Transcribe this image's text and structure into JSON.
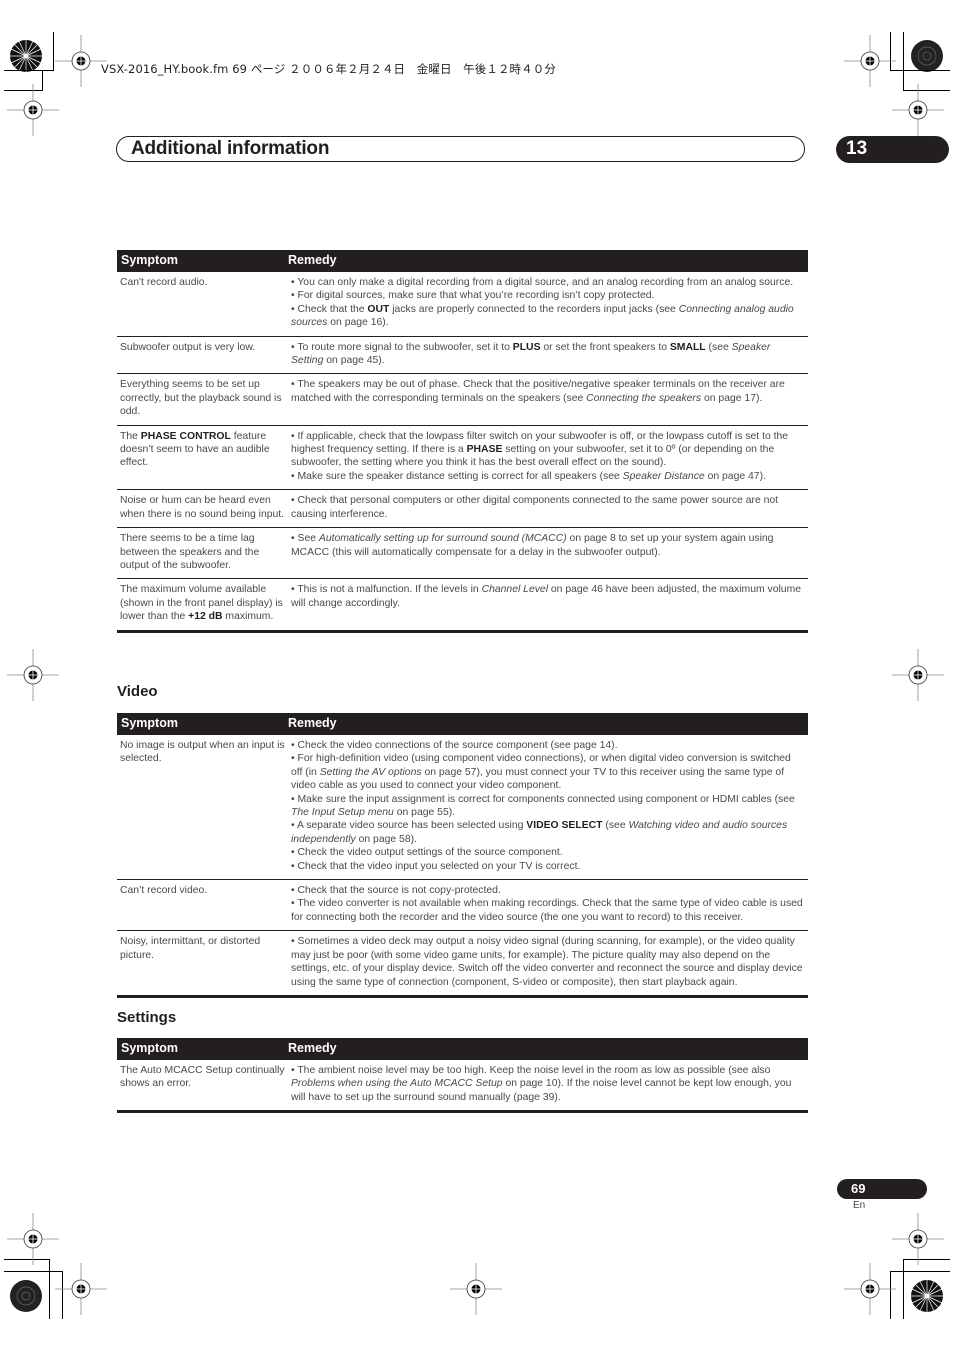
{
  "file_line": "VSX-2016_HY.book.fm  69 ページ  ２００６年２月２４日　金曜日　午後１２時４０分",
  "chapter": {
    "title": "Additional information",
    "number": "13"
  },
  "table_headers": {
    "symptom": "Symptom",
    "remedy": "Remedy"
  },
  "sections": [
    {
      "heading": "",
      "rows": [
        {
          "symptom": [
            {
              "t": "Can't record audio."
            }
          ],
          "remedy": [
            [
              {
                "t": "• You can only make a digital recording from a digital source, and an analog recording from an analog source."
              }
            ],
            [
              {
                "t": "• For digital sources, make sure that what you’re recording isn’t copy protected."
              }
            ],
            [
              {
                "t": "• Check that the "
              },
              {
                "t": "OUT",
                "b": true
              },
              {
                "t": " jacks are properly connected to the recorders input jacks (see "
              },
              {
                "t": "Connecting analog audio sources",
                "i": true
              },
              {
                "t": " on page 16)."
              }
            ]
          ]
        },
        {
          "symptom": [
            {
              "t": "Subwoofer output is very low."
            }
          ],
          "remedy": [
            [
              {
                "t": "• To route more signal to the subwoofer, set it to "
              },
              {
                "t": "PLUS",
                "b": true
              },
              {
                "t": " or set the front speakers to "
              },
              {
                "t": "SMALL",
                "b": true
              },
              {
                "t": " (see "
              },
              {
                "t": "Speaker Setting",
                "i": true
              },
              {
                "t": " on page 45)."
              }
            ]
          ]
        },
        {
          "symptom": [
            {
              "t": "Everything seems to be set up correctly, but the playback sound is odd."
            }
          ],
          "remedy": [
            [
              {
                "t": "• The speakers may be out of phase. Check that the positive/negative speaker terminals on the receiver are matched with the corresponding terminals on the speakers (see "
              },
              {
                "t": "Connecting the speakers",
                "i": true
              },
              {
                "t": " on page 17)."
              }
            ]
          ]
        },
        {
          "symptom": [
            {
              "t": "The "
            },
            {
              "t": "PHASE CONTROL",
              "b": true
            },
            {
              "t": " feature doesn’t seem to have an audible effect."
            }
          ],
          "remedy": [
            [
              {
                "t": "• If applicable, check that the lowpass filter switch on your subwoofer is off, or the lowpass cutoff is set to the highest frequency setting. If there is a "
              },
              {
                "t": "PHASE",
                "b": true
              },
              {
                "t": " setting on your subwoofer, set it to 0º (or depending on the subwoofer, the setting where you think it has the best overall effect on the sound)."
              }
            ],
            [
              {
                "t": "• Make sure the speaker distance setting is correct for all speakers (see "
              },
              {
                "t": "Speaker Distance",
                "i": true
              },
              {
                "t": " on page 47)."
              }
            ]
          ]
        },
        {
          "symptom": [
            {
              "t": "Noise or hum can be heard even when there is no sound being input."
            }
          ],
          "remedy": [
            [
              {
                "t": "• Check that personal computers or other digital components connected to the same power source are not causing interference."
              }
            ]
          ]
        },
        {
          "symptom": [
            {
              "t": "There seems to be a time lag between the speakers and the output of the subwoofer."
            }
          ],
          "remedy": [
            [
              {
                "t": "• See "
              },
              {
                "t": "Automatically setting up for surround sound (MCACC)",
                "i": true
              },
              {
                "t": " on page 8 to set up your system again using MCACC (this will automatically compensate for a delay in the subwoofer output)."
              }
            ]
          ]
        },
        {
          "symptom": [
            {
              "t": "The maximum volume available (shown in the front panel display) is lower than the "
            },
            {
              "t": "+12 dB",
              "b": true
            },
            {
              "t": " maximum."
            }
          ],
          "remedy": [
            [
              {
                "t": "• This is not a malfunction. If the levels in "
              },
              {
                "t": "Channel Level",
                "i": true
              },
              {
                "t": " on page 46 have been adjusted, the maximum volume will change accordingly."
              }
            ]
          ]
        }
      ]
    },
    {
      "heading": "Video",
      "rows": [
        {
          "symptom": [
            {
              "t": "No image is output when an input is selected."
            }
          ],
          "remedy": [
            [
              {
                "t": "• Check the video connections of the source component (see page 14)."
              }
            ],
            [
              {
                "t": "• For high-definition video (using component video connections), or when digital video conversion is switched off (in "
              },
              {
                "t": "Setting the AV options",
                "i": true
              },
              {
                "t": " on page 57), you must connect your TV to this receiver using the same type of video cable as you used to connect your video component."
              }
            ],
            [
              {
                "t": "• Make sure the input assignment is correct for components connected using component or HDMI cables (see "
              },
              {
                "t": "The Input Setup menu",
                "i": true
              },
              {
                "t": " on page 55)."
              }
            ],
            [
              {
                "t": "• A separate video source has been selected using "
              },
              {
                "t": "VIDEO SELECT",
                "b": true
              },
              {
                "t": " (see "
              },
              {
                "t": "Watching video and audio sources independently",
                "i": true
              },
              {
                "t": " on page 58)."
              }
            ],
            [
              {
                "t": "• Check the video output settings of the source component."
              }
            ],
            [
              {
                "t": "• Check that the video input you selected on your TV is correct."
              }
            ]
          ]
        },
        {
          "symptom": [
            {
              "t": "Can’t record video."
            }
          ],
          "remedy": [
            [
              {
                "t": "• Check that the source is not copy-protected."
              }
            ],
            [
              {
                "t": "• The video converter is not available when making recordings. Check that the same type of video cable is used for connecting both the recorder and the video source (the one you want to record) to this receiver."
              }
            ]
          ]
        },
        {
          "symptom": [
            {
              "t": "Noisy, intermittant, or distorted picture."
            }
          ],
          "remedy": [
            [
              {
                "t": "• Sometimes a video deck may output a noisy video signal (during scanning, for example), or the video quality may just be poor (with some video game units, for example). The picture quality may also depend on the settings, etc. of your display device. Switch off the video converter and reconnect the source and display device using the same type of connection (component, S-video or composite), then start playback again."
              }
            ]
          ]
        }
      ]
    },
    {
      "heading": "Settings",
      "rows": [
        {
          "symptom": [
            {
              "t": "The Auto MCACC Setup continually shows an error."
            }
          ],
          "remedy": [
            [
              {
                "t": "• The ambient noise level may be too high. Keep the noise level in the room as low as possible (see also "
              },
              {
                "t": "Problems when using the Auto MCACC Setup",
                "i": true
              },
              {
                "t": " on page 10). If the noise level cannot be kept low enough, you will have to set up the surround sound manually (page 39)."
              }
            ]
          ]
        }
      ]
    }
  ],
  "footer": {
    "page_number": "69",
    "language": "En"
  }
}
